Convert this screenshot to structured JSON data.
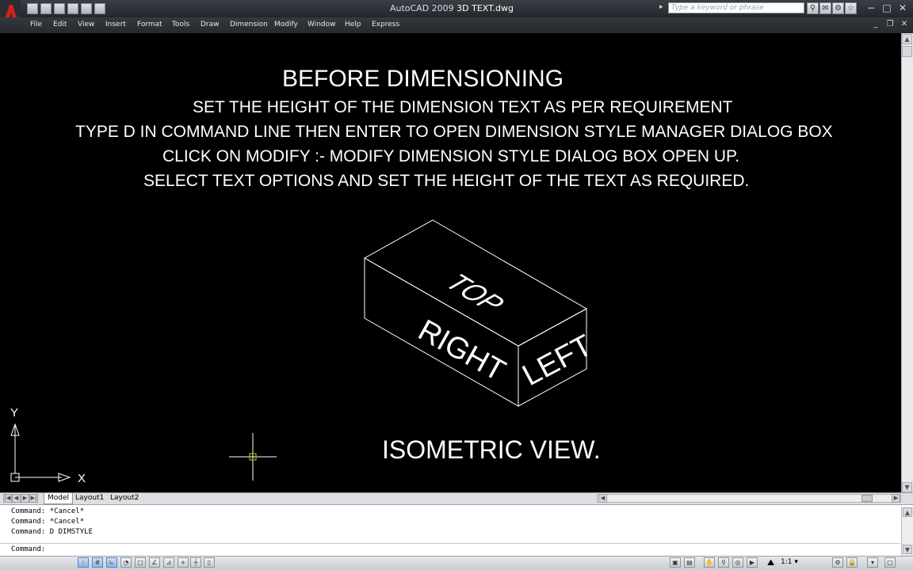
{
  "window": {
    "title": "AutoCAD 2009",
    "filename": "3D TEXT.dwg",
    "search_placeholder": "Type a keyword or phrase",
    "controls": [
      "−",
      "□",
      "✕"
    ]
  },
  "menu": [
    "File",
    "Edit",
    "View",
    "Insert",
    "Format",
    "Tools",
    "Draw",
    "Dimension",
    "Modify",
    "Window",
    "Help",
    "Express"
  ],
  "drawing": {
    "heading": "BEFORE DIMENSIONING",
    "instructions": [
      "SET THE HEIGHT OF THE DIMENSION TEXT AS PER REQUIREMENT",
      "TYPE D IN COMMAND LINE THEN ENTER TO OPEN DIMENSION STYLE MANAGER DIALOG BOX",
      "CLICK ON MODIFY :- MODIFY DIMENSION STYLE DIALOG BOX OPEN UP.",
      "SELECT TEXT OPTIONS AND SET THE HEIGHT OF THE TEXT AS REQUIRED."
    ],
    "box_faces": {
      "top": "TOP",
      "right": "RIGHT",
      "left": "LEFT"
    },
    "caption": "ISOMETRIC VIEW.",
    "ucs": {
      "y": "Y",
      "x": "X"
    }
  },
  "tabs": [
    "Model",
    "Layout1",
    "Layout2"
  ],
  "tab_nav": [
    "|◀",
    "◀",
    "▶",
    "▶|"
  ],
  "command_history": [
    "Command: *Cancel*",
    "Command: *Cancel*",
    "Command: D DIMSTYLE"
  ],
  "command_prompt": "Command:",
  "status": {
    "annotation_scale": "1:1"
  },
  "colors": {
    "canvas": "#000000",
    "drawing_lines": "#ffffff",
    "cursor": "#c8c800"
  }
}
